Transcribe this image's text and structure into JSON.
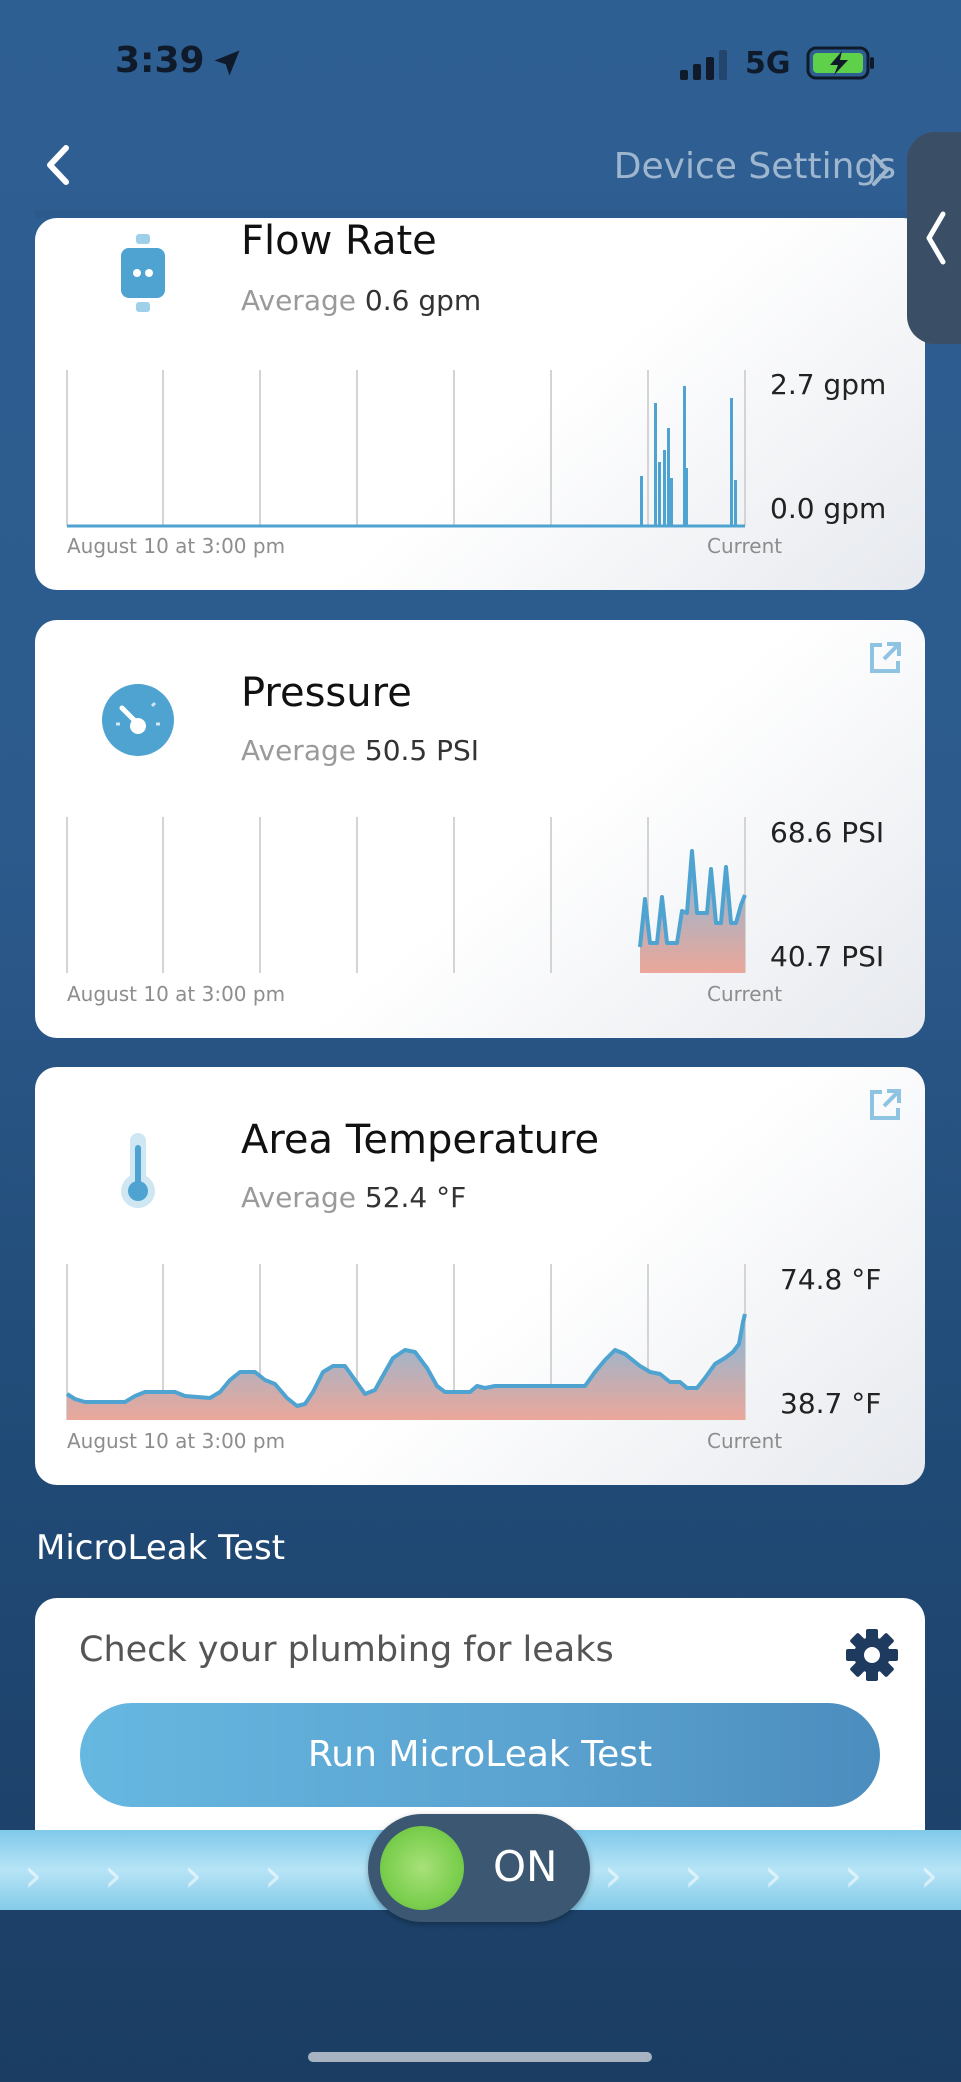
{
  "status_bar": {
    "time": "3:39",
    "network": "5G"
  },
  "nav": {
    "link_label": "Device Settings"
  },
  "flow_card": {
    "title": "Flow Rate",
    "average_label": "Average",
    "average_value": "0.6 gpm",
    "y_max": "2.7 gpm",
    "y_min": "0.0 gpm",
    "x_start": "August 10 at 3:00 pm",
    "x_end": "Current"
  },
  "pressure_card": {
    "title": "Pressure",
    "average_label": "Average",
    "average_value": "50.5 PSI",
    "y_max": "68.6 PSI",
    "y_min": "40.7 PSI",
    "x_start": "August 10 at 3:00 pm",
    "x_end": "Current"
  },
  "temp_card": {
    "title": "Area Temperature",
    "average_label": "Average",
    "average_value": "52.4 °F",
    "y_max": "74.8 °F",
    "y_min": "38.7 °F",
    "x_start": "August 10 at 3:00 pm",
    "x_end": "Current"
  },
  "microleak": {
    "section_title": "MicroLeak Test",
    "description": "Check your plumbing for leaks",
    "button_label": "Run MicroLeak Test"
  },
  "toggle": {
    "label": "ON"
  },
  "colors": {
    "accent": "#4fa3d1",
    "toggle_on": "#7ccf4f",
    "chart_fill_bottom": "#e8a59a"
  }
}
